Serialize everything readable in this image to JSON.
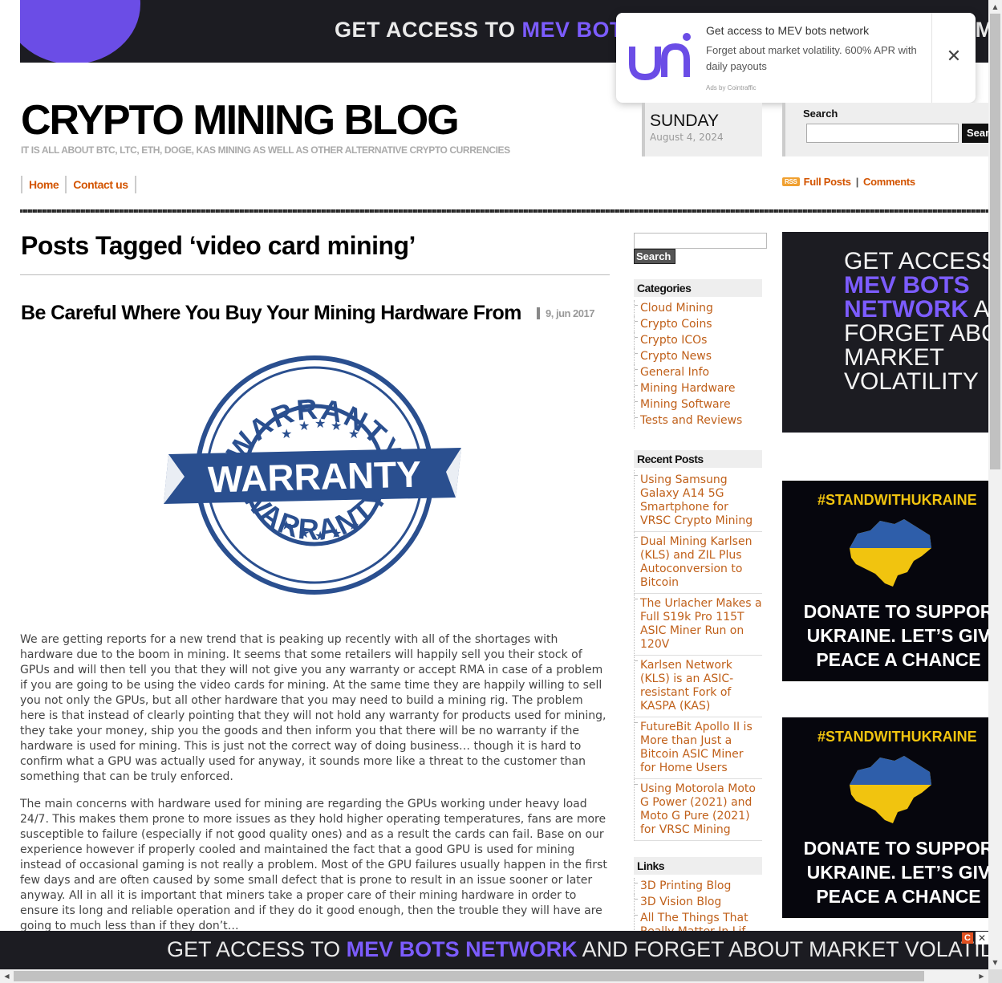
{
  "top_ad": {
    "prefix": "GET ACCESS TO ",
    "highlight": "MEV BOTS",
    "suffix": "",
    "tail": "MA"
  },
  "popup": {
    "title": "Get access to MEV bots network",
    "body": "Forget about market volatility. 600% APR with daily payouts",
    "ads_by": "Ads by Cointraffic",
    "close": "✕",
    "logo_icon": "uni-logo-icon"
  },
  "header": {
    "site_title": "CRYPTO MINING BLOG",
    "tagline": "IT IS ALL ABOUT BTC, LTC, ETH, DOGE, KAS MINING AS WELL AS OTHER ALTERNATIVE CRYPTO CURRENCIES",
    "day": "SUNDAY",
    "date": "August 4, 2024",
    "search_label": "Search",
    "search_button": "Sear"
  },
  "nav": {
    "home": "Home",
    "contact": "Contact us"
  },
  "feeds": {
    "rss_badge": "RSS",
    "full_posts": "Full Posts",
    "separator": "|",
    "comments": "Comments"
  },
  "main": {
    "page_title": "Posts Tagged ‘video card mining’",
    "post_title": "Be Careful Where You Buy Your Mining Hardware From",
    "post_date": "9, jun 2017",
    "image_words": {
      "top": "WARRANTY",
      "middle": "WARRANTY",
      "bottom": "WARRANTY"
    },
    "para1": "We are getting reports for a new trend that is peaking up recently with all of the shortages with hardware due to the boom in mining. It seems that some retailers will happily sell you their stock of GPUs and will then tell you that they will not give you any warranty or accept RMA in case of a problem if you are going to be using the video cards for mining. At the same time they are happily willing to sell you not only the GPUs, but all other hardware that you may need to build a mining rig. The problem here is that instead of clearly pointing that they will not hold any warranty for products used for mining, they take your money, ship you the goods and then inform you that there will be no warranty if the hardware is used for mining. This is just not the correct way of doing business… though it is hard to confirm what a GPU was actually used for anyway, it sounds more like a threat to the customer than something that can be truly enforced.",
    "para2": "The main concerns with hardware used for mining are regarding the GPUs working under heavy load 24/7. This makes them prone to more issues as they hold higher operating temperatures, fans are more susceptible to failure (especially if not good quality ones) and as a result the cards can fail. Base on our experience however if properly cooled and maintained the fact that a good GPU is used for mining instead of occasional gaming is not really a problem. Most of the GPU failures usually happen in the first few days and are often caused by some small defect that is prone to result in an issue sooner or later anyway. All in all it is important that miners take a proper care of their mining hardware in order to ensure its long and reliable operation and if they do it good enough, then the trouble they will have are going to much less than if they don’t…"
  },
  "sidebar": {
    "search_button": "Search",
    "categories_title": "Categories",
    "categories": [
      "Cloud Mining",
      "Crypto Coins",
      "Crypto ICOs",
      "Crypto News",
      "General Info",
      "Mining Hardware",
      "Mining Software",
      "Tests and Reviews"
    ],
    "recent_title": "Recent Posts",
    "recent": [
      "Using Samsung Galaxy A14 5G Smartphone for VRSC Crypto Mining",
      "Dual Mining Karlsen (KLS) and ZIL Plus Autoconversion to Bitcoin",
      "The Urlacher Makes a Full S19k Pro 115T ASIC Miner Run on 120V",
      "Karlsen Network (KLS) is an ASIC-resistant Fork of KASPA (KAS)",
      "FutureBit Apollo II is More than Just a Bitcoin ASIC Miner for Home Users",
      "Using Motorola Moto G Power (2021) and Moto G Pure (2021) for VRSC Mining"
    ],
    "links_title": "Links",
    "links": [
      "3D Printing Blog",
      "3D Vision Blog",
      "All The Things That Really Matter In Lif"
    ]
  },
  "right_ads": {
    "mev": {
      "line1": "GET ACCESS",
      "line2": "MEV BOTS",
      "line3a": "NETWORK",
      "line3b": " A",
      "line4": "FORGET ABO",
      "line5": "MARKET",
      "line6": "VOLATILITY"
    },
    "ukraine": {
      "tag": "#STANDWITHUKRAINE",
      "line1": "DONATE TO SUPPOR",
      "line2": "UKRAINE. LET’S GIV",
      "line3": "PEACE A CHANCE"
    }
  },
  "bottom_ad": {
    "prefix": "GET ACCESS TO ",
    "highlight": "MEV BOTS NETWORK",
    "suffix": " AND FORGET ABOUT MARKET VOLATILITY",
    "badge": "C",
    "close": "✕"
  },
  "scrollbars": {
    "up": "▲",
    "down": "▼",
    "left": "◀",
    "right": "▶"
  },
  "colors": {
    "accent_orange": "#d35400",
    "mev_purple": "#7c5cff",
    "ad_dark": "#1c1c22",
    "ukraine_blue": "#2e5eaa",
    "ukraine_yellow": "#f1c40f",
    "stamp_blue": "#2a4f8f"
  }
}
